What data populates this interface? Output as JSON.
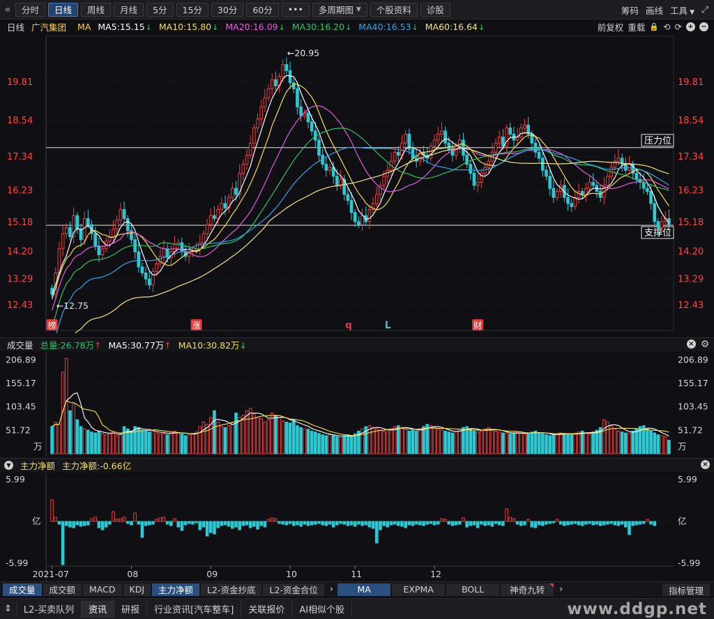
{
  "toolbar": {
    "back_icon": "«",
    "buttons": [
      "分时",
      "日线",
      "周线",
      "月线",
      "5分",
      "15分",
      "30分",
      "60分",
      "•••",
      "多周期图",
      "个股资料",
      "诊股"
    ],
    "active_index": 1,
    "dropdown_index": 9,
    "right": [
      "筹码",
      "画线",
      "工具"
    ],
    "expand_icon": "⤢"
  },
  "ma_line": {
    "period": "日线",
    "stock": "广汽集团",
    "ma_label": "MA",
    "items": [
      {
        "text": "MA5:15.15",
        "color": "#ffffff"
      },
      {
        "text": "MA10:15.80",
        "color": "#f5e14a"
      },
      {
        "text": "MA20:16.09",
        "color": "#e55de0"
      },
      {
        "text": "MA30:16.20",
        "color": "#2fc46a"
      },
      {
        "text": "MA40:16.53",
        "color": "#29a8e8"
      },
      {
        "text": "MA60:16.64",
        "color": "#f0e68c"
      }
    ],
    "down_arrow": "↓",
    "right_labels": [
      "前复权",
      "重载"
    ],
    "right_icons": [
      "🔒",
      "⟲",
      "⟳",
      "+",
      "−"
    ]
  },
  "colors": {
    "up": "#e84141",
    "down": "#2cc9d3",
    "price_axis": "#ff4444",
    "grid": "#2a2a33",
    "level_line": "#e6e6e6"
  },
  "price_axis": {
    "ticks": [
      19.81,
      18.54,
      17.34,
      16.23,
      15.18,
      14.2,
      13.29,
      12.43
    ],
    "min": 11.85,
    "max": 21.2
  },
  "annotations": {
    "high": "←20.95",
    "low": "←12.75",
    "resistance": "压力位",
    "support": "支撑位",
    "resistance_price": 17.65,
    "support_price": 15.08
  },
  "event_markers": [
    {
      "text": "榜",
      "type": "box",
      "index": 0
    },
    {
      "text": "涨",
      "type": "box",
      "index": 40
    },
    {
      "text": "q",
      "type": "text",
      "index": 82
    },
    {
      "text": "L",
      "type": "text",
      "index": 93
    },
    {
      "text": "财",
      "type": "box",
      "index": 118
    }
  ],
  "chart_data": {
    "type": "candlestick",
    "title": "广汽集团 日线",
    "open": [
      13.0,
      12.8,
      13.5,
      14.3,
      14.8,
      15.0,
      14.7,
      15.4,
      14.95,
      14.6,
      15.3,
      15.1,
      14.8,
      14.4,
      14.1,
      14.3,
      14.55,
      14.7,
      14.95,
      15.25,
      15.6,
      15.3,
      14.9,
      14.6,
      14.2,
      13.7,
      13.5,
      13.3,
      13.1,
      13.55,
      13.8,
      14.05,
      14.3,
      14.0,
      14.2,
      14.45,
      14.5,
      14.2,
      14.05,
      14.2,
      14.25,
      14.3,
      14.5,
      14.8,
      15.1,
      15.4,
      15.3,
      15.6,
      15.8,
      15.65,
      16.0,
      16.3,
      16.1,
      16.8,
      17.1,
      17.4,
      17.8,
      18.3,
      18.6,
      19.0,
      19.3,
      19.6,
      19.9,
      19.7,
      20.0,
      20.4,
      20.2,
      19.8,
      19.6,
      19.0,
      18.7,
      18.8,
      18.5,
      18.2,
      17.9,
      17.4,
      17.1,
      16.9,
      17.0,
      16.7,
      16.4,
      16.6,
      16.1,
      15.9,
      15.5,
      15.2,
      15.1,
      15.4,
      15.2,
      15.6,
      15.8,
      16.1,
      16.4,
      16.7,
      16.9,
      17.2,
      17.5,
      17.4,
      17.8,
      18.1,
      17.6,
      17.3,
      17.2,
      17.5,
      17.4,
      17.3,
      17.7,
      17.9,
      18.1,
      18.2,
      17.8,
      17.6,
      17.4,
      17.7,
      17.9,
      17.4,
      17.1,
      16.8,
      16.4,
      16.5,
      16.8,
      17.0,
      17.2,
      17.5,
      17.8,
      18.0,
      17.7,
      18.3,
      18.1,
      17.9,
      18.0,
      18.3,
      18.4,
      18.1,
      17.8,
      17.5,
      17.3,
      16.9,
      16.7,
      16.3,
      16.0,
      16.2,
      16.4,
      16.0,
      15.8,
      15.7,
      16.0,
      16.2,
      16.1,
      16.3,
      16.5,
      16.4,
      16.2,
      16.0,
      16.4,
      16.7,
      17.0,
      17.2,
      17.3,
      17.1,
      16.9,
      17.1,
      16.8,
      16.6,
      16.5,
      16.3,
      16.2,
      15.8,
      15.2,
      15.0,
      15.2,
      15.3
    ],
    "close": [
      12.8,
      13.5,
      14.3,
      14.8,
      15.0,
      14.7,
      15.4,
      14.95,
      14.6,
      15.3,
      15.1,
      14.8,
      14.4,
      14.1,
      14.3,
      14.55,
      14.7,
      14.95,
      15.25,
      15.6,
      15.3,
      14.9,
      14.6,
      14.2,
      13.7,
      13.5,
      13.3,
      13.1,
      13.55,
      13.8,
      14.05,
      14.3,
      14.0,
      14.2,
      14.45,
      14.5,
      14.2,
      14.05,
      14.2,
      14.25,
      14.3,
      14.5,
      14.8,
      15.1,
      15.4,
      15.3,
      15.6,
      15.8,
      15.65,
      16.0,
      16.3,
      16.1,
      16.8,
      17.1,
      17.4,
      17.8,
      18.3,
      18.6,
      19.0,
      19.3,
      19.6,
      19.9,
      19.7,
      20.0,
      20.4,
      20.2,
      19.8,
      19.6,
      19.0,
      18.7,
      18.8,
      18.5,
      18.2,
      17.9,
      17.4,
      17.1,
      16.9,
      17.0,
      16.7,
      16.4,
      16.6,
      16.1,
      15.9,
      15.5,
      15.2,
      15.1,
      15.4,
      15.2,
      15.6,
      15.8,
      16.1,
      16.4,
      16.7,
      16.9,
      17.2,
      17.5,
      17.4,
      17.8,
      18.1,
      17.6,
      17.3,
      17.2,
      17.5,
      17.4,
      17.3,
      17.7,
      17.9,
      18.1,
      18.2,
      17.8,
      17.6,
      17.4,
      17.7,
      17.9,
      17.4,
      17.1,
      16.8,
      16.4,
      16.5,
      16.8,
      17.0,
      17.2,
      17.5,
      17.8,
      18.0,
      17.7,
      18.3,
      18.1,
      17.9,
      18.0,
      18.3,
      18.4,
      18.1,
      17.8,
      17.5,
      17.3,
      16.9,
      16.7,
      16.3,
      16.0,
      16.2,
      16.4,
      16.0,
      15.8,
      15.7,
      16.0,
      16.2,
      16.1,
      16.3,
      16.5,
      16.4,
      16.2,
      16.0,
      16.4,
      16.7,
      17.0,
      17.2,
      17.3,
      17.1,
      16.9,
      17.1,
      16.8,
      16.6,
      16.5,
      16.3,
      16.2,
      15.8,
      15.2,
      15.0,
      15.2,
      15.3,
      15.1
    ],
    "ma": [
      {
        "name": "MA5",
        "color": "#ffffff"
      },
      {
        "name": "MA10",
        "color": "#f5e14a"
      },
      {
        "name": "MA20",
        "color": "#e55de0"
      },
      {
        "name": "MA30",
        "color": "#2fc46a"
      },
      {
        "name": "MA40",
        "color": "#29a8e8"
      },
      {
        "name": "MA60",
        "color": "#f0e68c"
      }
    ],
    "x_labels": [
      {
        "text": "2021-07",
        "index": 0
      },
      {
        "text": "08",
        "index": 22
      },
      {
        "text": "09",
        "index": 44
      },
      {
        "text": "10",
        "index": 66
      },
      {
        "text": "11",
        "index": 84
      },
      {
        "text": "12",
        "index": 106
      }
    ]
  },
  "volume": {
    "title": "成交量",
    "total": "总量:26.78万",
    "ma5": "MA5:30.77万",
    "ma10": "MA10:30.82万",
    "up_arrow": "↑",
    "down_arrow": "↓",
    "ticks": [
      206.89,
      155.17,
      103.45,
      51.72
    ],
    "unit": "万",
    "max": 215,
    "values": [
      60,
      70,
      65,
      180,
      210,
      95,
      110,
      75,
      60,
      55,
      52,
      48,
      46,
      50,
      45,
      42,
      44,
      48,
      40,
      42,
      60,
      55,
      50,
      60,
      58,
      52,
      50,
      48,
      50,
      46,
      44,
      45,
      42,
      48,
      50,
      46,
      44,
      40,
      42,
      45,
      48,
      60,
      70,
      65,
      80,
      95,
      70,
      60,
      58,
      62,
      70,
      90,
      80,
      85,
      95,
      100,
      88,
      80,
      78,
      70,
      75,
      90,
      85,
      80,
      72,
      70,
      68,
      75,
      62,
      58,
      55,
      54,
      50,
      48,
      45,
      42,
      40,
      42,
      40,
      38,
      36,
      40,
      42,
      38,
      44,
      50,
      55,
      60,
      62,
      58,
      55,
      52,
      50,
      48,
      55,
      60,
      62,
      58,
      55,
      50,
      52,
      50,
      55,
      60,
      65,
      62,
      58,
      55,
      52,
      50,
      48,
      46,
      50,
      55,
      58,
      60,
      55,
      50,
      48,
      50,
      55,
      58,
      52,
      50,
      48,
      46,
      45,
      44,
      46,
      48,
      45,
      44,
      46,
      48,
      50,
      45,
      44,
      42,
      40,
      42,
      44,
      46,
      45,
      44,
      42,
      45,
      48,
      50,
      46,
      44,
      48,
      52,
      58,
      75,
      70,
      62,
      55,
      50,
      48,
      46,
      45,
      50,
      55,
      60,
      62,
      55,
      50,
      46,
      42,
      40,
      38,
      30
    ]
  },
  "net_flow": {
    "title": "主力净额",
    "value": "主力净额:-0.66亿",
    "ticks_top": "5.99",
    "ticks_mid": "亿",
    "ticks_bottom": "-5.99",
    "max": 6,
    "values": [
      3.1,
      0.6,
      -0.4,
      -6.2,
      -0.6,
      -0.8,
      -0.9,
      -0.5,
      -0.7,
      -0.6,
      -0.5,
      0.4,
      0.6,
      -0.9,
      -1.2,
      -0.8,
      -0.4,
      1.4,
      0.3,
      0.4,
      0.6,
      -0.3,
      -0.5,
      1.2,
      -0.4,
      -2.3,
      -0.6,
      -0.5,
      -0.4,
      0.3,
      0.5,
      0.6,
      -0.4,
      -0.6,
      0.4,
      -0.8,
      -1.3,
      -0.5,
      -0.3,
      -0.4,
      -0.2,
      -1.2,
      -0.8,
      -2.1,
      -1.6,
      -1.8,
      -0.9,
      -0.6,
      -0.5,
      -0.7,
      -1.0,
      -0.8,
      -1.2,
      -0.6,
      -0.5,
      -0.9,
      -0.7,
      -1.1,
      -0.6,
      -0.8,
      0.3,
      0.5,
      0.4,
      -0.3,
      -0.4,
      -0.5,
      -0.3,
      -0.6,
      -0.5,
      -0.7,
      -0.4,
      -0.6,
      -0.5,
      -0.4,
      -0.3,
      -0.5,
      -0.6,
      -0.4,
      -0.8,
      -0.5,
      -0.3,
      -0.4,
      -0.6,
      -0.5,
      -0.7,
      -0.4,
      -0.6,
      -0.5,
      -0.8,
      -1.0,
      -3.1,
      -1.2,
      -0.6,
      -0.8,
      -0.5,
      -0.4,
      -0.6,
      -0.7,
      -0.9,
      -0.5,
      -0.6,
      -0.4,
      -0.5,
      -0.6,
      -0.4,
      -0.3,
      -0.5,
      -0.4,
      0.4,
      0.3,
      -0.4,
      -0.6,
      -0.5,
      -0.4,
      0.5,
      -0.8,
      -0.6,
      -0.5,
      -0.9,
      -0.4,
      -0.6,
      -0.5,
      -0.7,
      -0.3,
      -0.5,
      -0.6,
      1.8,
      0.6,
      0.4,
      -0.4,
      -0.6,
      -0.5,
      0.3,
      -0.8,
      -0.9,
      -0.5,
      -0.6,
      -0.4,
      -0.3,
      -0.2,
      0.3,
      -0.4,
      -0.6,
      -0.5,
      -0.4,
      -0.3,
      -0.5,
      -0.6,
      -0.4,
      -0.3,
      -0.5,
      -0.4,
      -0.6,
      -0.5,
      -0.4,
      -0.3,
      -0.5,
      -0.6,
      -0.4,
      -0.8,
      -1.9,
      -0.6,
      -0.5,
      -0.4,
      -0.3,
      0.3,
      -0.4,
      -0.6
    ]
  },
  "tabs1": {
    "left": [
      "成交量",
      "成交额",
      "MACD",
      "KDJ",
      "主力净额",
      "L2-资金抄底",
      "L2-资金合位"
    ],
    "left_active": [
      0,
      4
    ],
    "right": [
      "MA",
      "EXPMA",
      "BOLL",
      "神奇九转"
    ],
    "right_active": 0,
    "flag_index": 3,
    "more": "›",
    "manage": "指标管理"
  },
  "tabs2": {
    "items": [
      "L2-买卖队列",
      "资讯",
      "研报",
      "行业资讯[汽车整车]",
      "关联报价",
      "AI相似个股"
    ],
    "active": 1,
    "chevron": "⇕"
  },
  "watermark": "www.ddgp.net"
}
